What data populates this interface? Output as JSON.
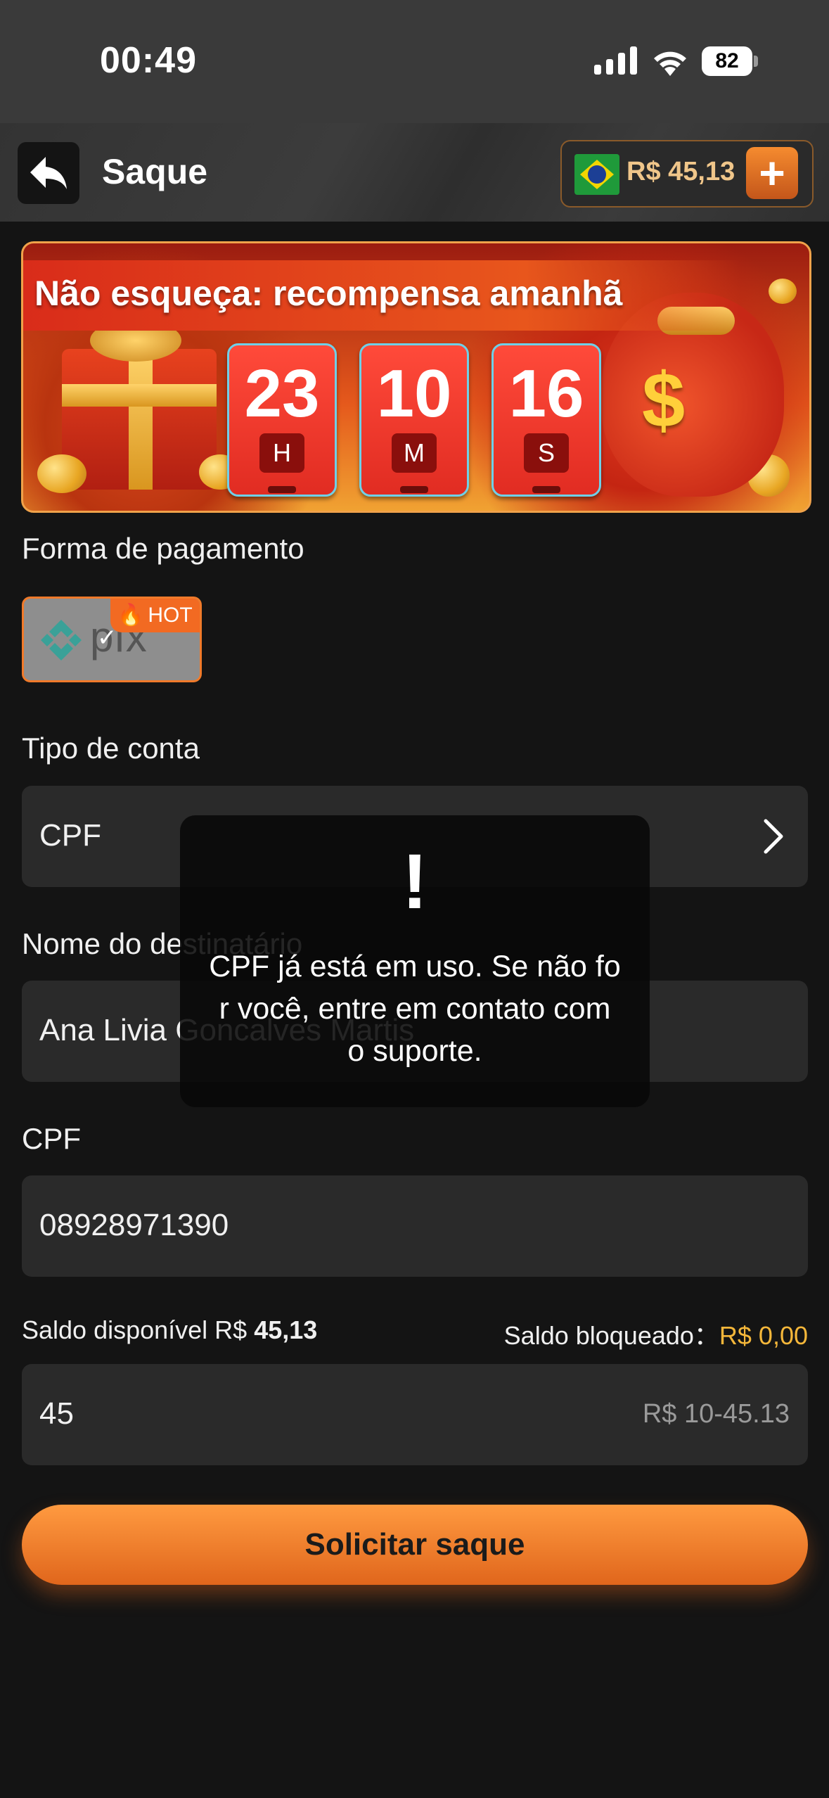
{
  "status_bar": {
    "time": "00:49",
    "battery": "82"
  },
  "header": {
    "title": "Saque",
    "balance": "R$ 45,13"
  },
  "banner": {
    "title": "Não esqueça: recompensa amanhã",
    "countdown": [
      {
        "value": "23",
        "unit": "H"
      },
      {
        "value": "10",
        "unit": "M"
      },
      {
        "value": "16",
        "unit": "S"
      }
    ]
  },
  "payment": {
    "label": "Forma de pagamento",
    "method": "pix",
    "badge": "HOT"
  },
  "account_type": {
    "label": "Tipo de conta",
    "value": "CPF"
  },
  "recipient": {
    "label": "Nome do destinatário",
    "value": "Ana Livia Goncalves Martis"
  },
  "cpf": {
    "label": "CPF",
    "value": "08928971390"
  },
  "balances": {
    "available_label": "Saldo disponível R$ ",
    "available_value": "45,13",
    "blocked_label": "Saldo bloqueado：",
    "blocked_value": "R$ 0,00"
  },
  "amount": {
    "value": "45",
    "range_hint": "R$ 10-45.13"
  },
  "submit_label": "Solicitar saque",
  "toast": {
    "icon": "!",
    "message": "CPF já está em uso. Se não for você, entre em contato com o suporte."
  },
  "colors": {
    "accent": "#f07a2a",
    "gold": "#f5b73a",
    "background": "#141414",
    "field": "#2a2a2a"
  }
}
